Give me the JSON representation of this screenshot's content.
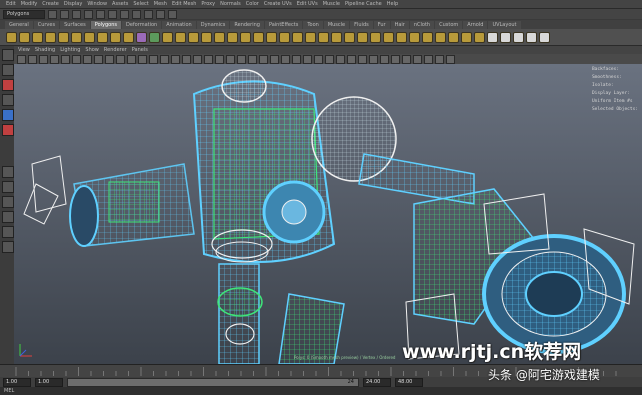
{
  "menubar": {
    "items": [
      "Edit",
      "Modify",
      "Create",
      "Display",
      "Window",
      "Assets",
      "Select",
      "Mesh",
      "Edit Mesh",
      "Proxy",
      "Normals",
      "Color",
      "Create UVs",
      "Edit UVs",
      "Muscle",
      "Pipeline Cache",
      "Help"
    ]
  },
  "status": {
    "mode_dropdown": "Polygons"
  },
  "shelf": {
    "tabs": [
      "General",
      "Curves",
      "Surfaces",
      "Polygons",
      "Deformation",
      "Animation",
      "Dynamics",
      "Rendering",
      "PaintEffects",
      "Toon",
      "Muscle",
      "Fluids",
      "Fur",
      "Hair",
      "nCloth",
      "Custom",
      "Arnold",
      "UVLayout"
    ],
    "active_tab": "Polygons"
  },
  "panel_menu": {
    "items": [
      "View",
      "Shading",
      "Lighting",
      "Show",
      "Renderer",
      "Panels"
    ]
  },
  "hud": {
    "lines": [
      "Backfaces:",
      "Smoothness:",
      "Isolate:",
      "Display Layer:",
      "Uniform Item #s",
      "Selected Objects:"
    ]
  },
  "viewport": {
    "status_text": "Polys: 0 (Smooth mesh preview) / Vertex / Ordered"
  },
  "timeline": {
    "start": "1.00",
    "range_start": "1.00",
    "range_end": "24",
    "end_field": "24.00",
    "max_field": "48.00"
  },
  "cmdline": {
    "label": "MEL"
  },
  "overlay": {
    "watermark": "www.rjtj.cn软荐网",
    "credit": "头条 @阿宅游戏建模"
  },
  "colors": {
    "wire_blue": "#5fd0ff",
    "wire_green": "#3ee67a",
    "wire_white": "#f0f0f0",
    "viewport_top": "#6a7280",
    "viewport_bottom": "#3c424b"
  }
}
